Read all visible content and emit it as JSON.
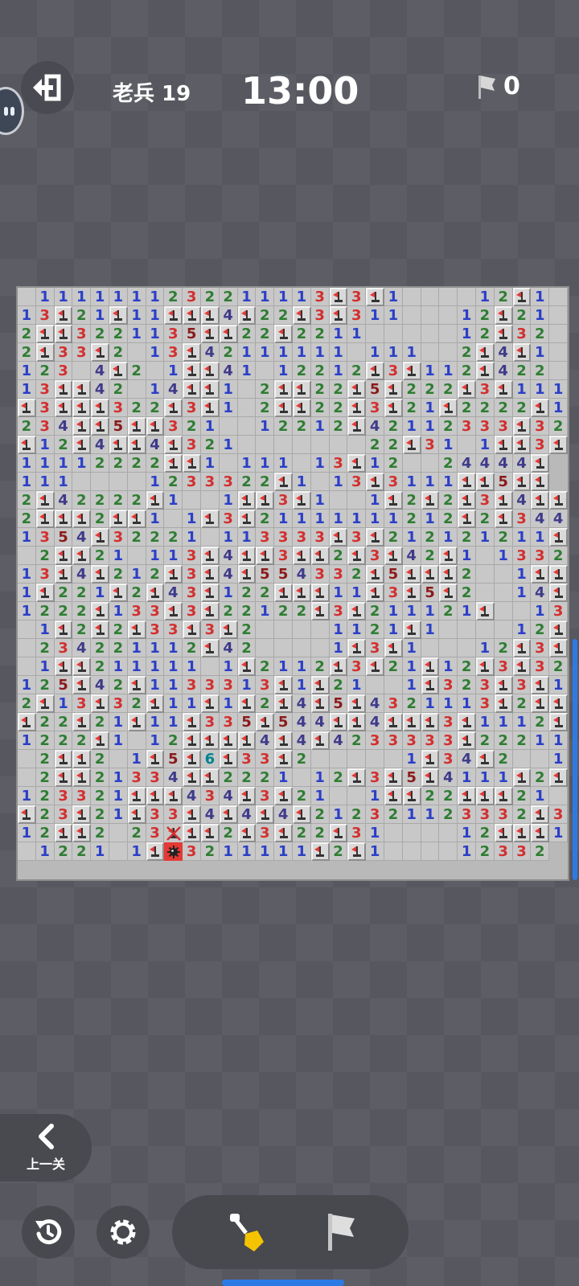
{
  "header": {
    "exit_icon": "exit-icon",
    "level_label": "老兵 19",
    "timer": "13:00",
    "flag_icon": "flag-icon",
    "flag_count": "0"
  },
  "board": {
    "columns": 30,
    "rows": 32,
    "legend": "digit = revealed number, F = flag, . = revealed empty, X = wrongly flagged cell, M = exploded mine",
    "grid": [
      ".1111111232211113F3F1....12F1.",
      "13F21F11FFF4F22F3F311...12F21.",
      "2FF3221135FF22F2211.....12F32.",
      "2F33F2.13F42111111.111..2F4F1.",
      "123.4F2.1FF41.12212F3F112F422.",
      "13FF42.14FF1.2FF22F5F222F3F111",
      "F3FFF322F3F1.2FF22F3F21F2222F1",
      "234FF5FF321..12212F42112333F32",
      "F12F4FF4F321.......22F31.1FF3F2",
      "11112222FF1.111.13F12..24444F",
      "111....1233322F1.13F3111FF5FF",
      "2F42222F1..1FF3F1..1F2F2F3F4FFF",
      "2FFF2FF1.1F3F21111111212F2F3443",
      "1354F32221.113333F3F212121211F1",
      ".2FF21.113F4FF3FF2F3F42F1.1332",
      "13F4F212F3F4F554332F5FFF2..1FF2",
      "1F221F2F43F122FFF11F3F5F2..14F4",
      "1222F133F3F22122F3F211121F..13F3",
      ".1F2F2F33F3F2....1121F1....12F43",
      ".234221112F42....1F3F1...12F3F1",
      ".1FF211111.1F2112F3F21F12F3F32",
      "125F42F1133313F1F21..1F323F3F1",
      "2F13F32F11F1F2F4F5F4321113F2FFF3",
      "F22F21F11F335F544FF4FFF3F1112F32F5FF",
      "1222F1.12FFFF4F4F4233333F2221133F",
      ".2FF2.1F5F6F33F2.....1F34F2..1F43",
      ".2FF21334FF2221.12F3F5F4111F2F",
      "123321FFF434F3F21..1FF22FFF21.22",
      "F23F21F33F4F4F4F212321123332F33F4F",
      "12FF2.23XFF2F3F22F31....12FFF1F",
      ".1221.1FM3211111F2F1....12332"
    ]
  },
  "navigation": {
    "prev_icon": "chevron-left-icon",
    "prev_label": "上一关"
  },
  "toolbar": {
    "restart_icon": "restart-icon",
    "settings_icon": "gear-icon",
    "dig_icon": "shovel-icon",
    "flag_mode_icon": "flag-icon"
  }
}
